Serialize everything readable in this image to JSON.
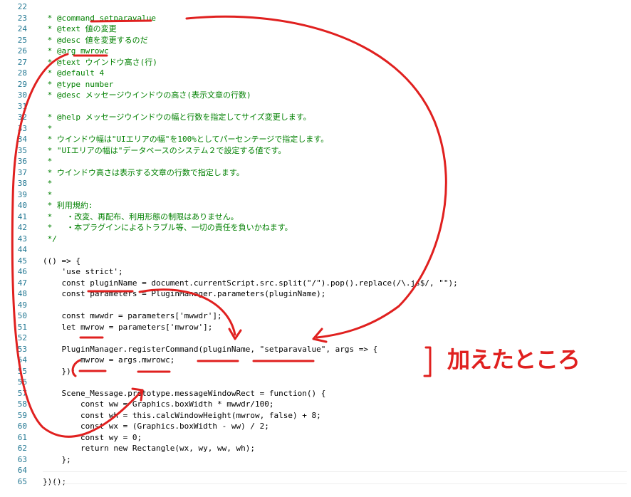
{
  "editor": {
    "lines": [
      {
        "n": "22",
        "t": ""
      },
      {
        "n": "23",
        "t": " * @command setparavalue"
      },
      {
        "n": "24",
        "t": " * @text 値の変更"
      },
      {
        "n": "25",
        "t": " * @desc 値を変更するのだ"
      },
      {
        "n": "26",
        "t": " * @arg mwrowc"
      },
      {
        "n": "27",
        "t": " * @text ウインドウ高さ(行)"
      },
      {
        "n": "28",
        "t": " * @default 4"
      },
      {
        "n": "29",
        "t": " * @type number"
      },
      {
        "n": "30",
        "t": " * @desc メッセージウインドウの高さ(表示文章の行数)"
      },
      {
        "n": "31",
        "t": ""
      },
      {
        "n": "32",
        "t": " * @help メッセージウインドウの幅と行数を指定してサイズ変更します。"
      },
      {
        "n": "33",
        "t": " *"
      },
      {
        "n": "34",
        "t": " * ウインドウ幅は\"UIエリアの幅\"を100%としてパーセンテージで指定します。"
      },
      {
        "n": "35",
        "t": " * \"UIエリアの幅は\"データベースのシステム２で設定する値です。"
      },
      {
        "n": "36",
        "t": " *"
      },
      {
        "n": "37",
        "t": " * ウインドウ高さは表示する文章の行数で指定します。"
      },
      {
        "n": "38",
        "t": " *"
      },
      {
        "n": "39",
        "t": " *"
      },
      {
        "n": "40",
        "t": " * 利用規約:"
      },
      {
        "n": "41",
        "t": " *   ・改変、再配布、利用形態の制限はありません。"
      },
      {
        "n": "42",
        "t": " *   ・本プラグインによるトラブル等、一切の責任を負いかねます。"
      },
      {
        "n": "43",
        "t": " */"
      },
      {
        "n": "44",
        "t": ""
      },
      {
        "n": "45",
        "t": "(() => {"
      },
      {
        "n": "46",
        "t": "    'use strict';"
      },
      {
        "n": "47",
        "t": "    const pluginName = document.currentScript.src.split(\"/\").pop().replace(/\\.js$/, \"\");"
      },
      {
        "n": "48",
        "t": "    const parameters = PluginManager.parameters(pluginName);"
      },
      {
        "n": "49",
        "t": ""
      },
      {
        "n": "50",
        "t": "    const mwwdr = parameters['mwwdr'];"
      },
      {
        "n": "51",
        "t": "    let mwrow = parameters['mwrow'];"
      },
      {
        "n": "52",
        "t": ""
      },
      {
        "n": "53",
        "t": "    PluginManager.registerCommand(pluginName, \"setparavalue\", args => {"
      },
      {
        "n": "54",
        "t": "        mwrow = args.mwrowc;"
      },
      {
        "n": "55",
        "t": "    });"
      },
      {
        "n": "56",
        "t": ""
      },
      {
        "n": "57",
        "t": "    Scene_Message.prototype.messageWindowRect = function() {"
      },
      {
        "n": "58",
        "t": "        const ww = Graphics.boxWidth * mwwdr/100;"
      },
      {
        "n": "59",
        "t": "        const wh = this.calcWindowHeight(mwrow, false) + 8;"
      },
      {
        "n": "60",
        "t": "        const wx = (Graphics.boxWidth - ww) / 2;"
      },
      {
        "n": "61",
        "t": "        const wy = 0;"
      },
      {
        "n": "62",
        "t": "        return new Rectangle(wx, wy, ww, wh);"
      },
      {
        "n": "63",
        "t": "    };"
      },
      {
        "n": "64",
        "t": ""
      },
      {
        "n": "65",
        "t": "})();"
      }
    ]
  },
  "annotation": {
    "note": "加えたところ",
    "color": "#e0201f"
  },
  "colors": {
    "comment": "#008000",
    "code": "#000000",
    "line_number": "#237893",
    "highlight_border": "#d8c267"
  }
}
